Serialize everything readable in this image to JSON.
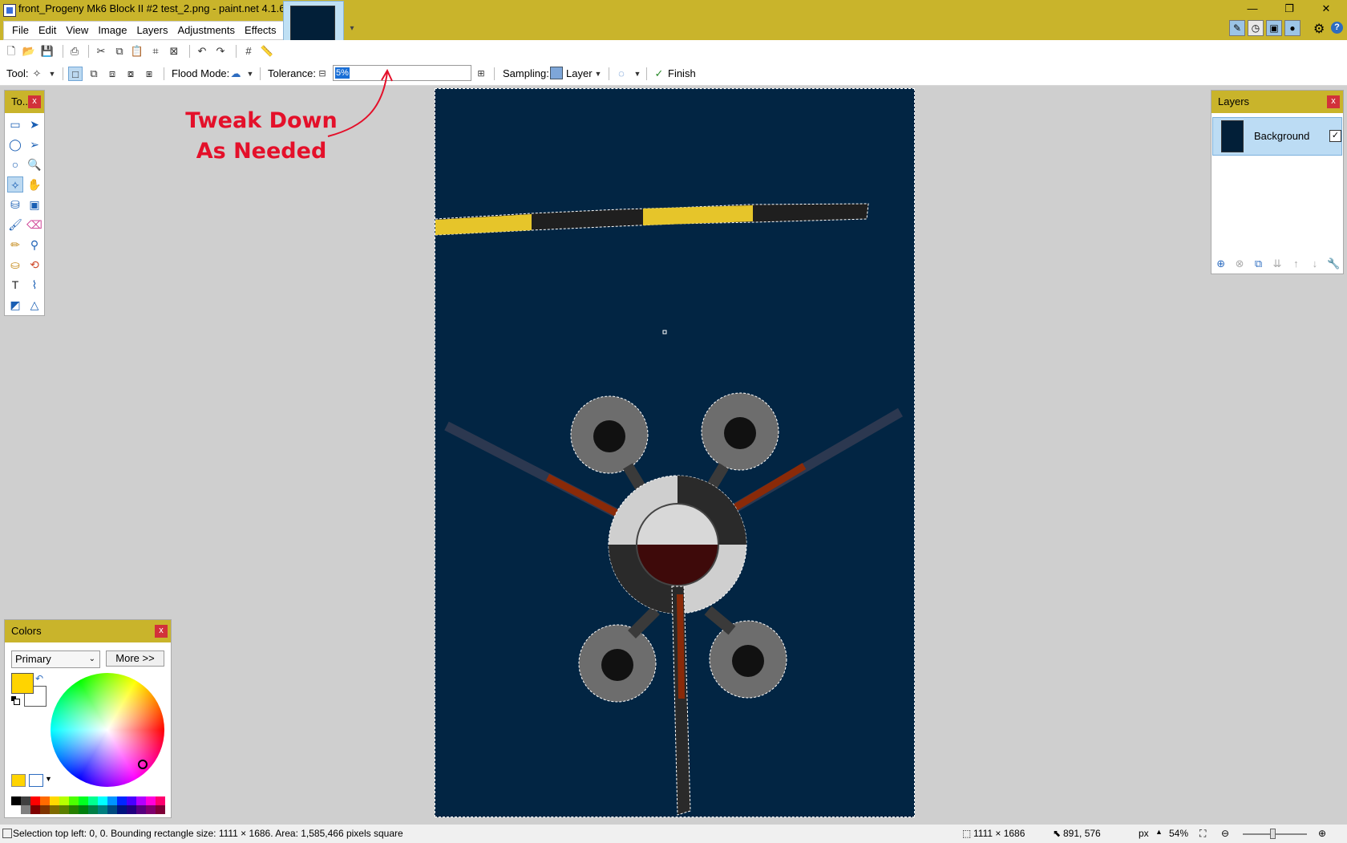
{
  "window": {
    "title": "front_Progeny Mk6 Block II #2 test_2.png - paint.net 4.1.6",
    "minimize": "—",
    "restore": "❐",
    "close": "✕"
  },
  "menu": [
    {
      "label": "File"
    },
    {
      "label": "Edit"
    },
    {
      "label": "View"
    },
    {
      "label": "Image"
    },
    {
      "label": "Layers"
    },
    {
      "label": "Adjustments"
    },
    {
      "label": "Effects"
    }
  ],
  "toolbar": {
    "tool_label": "Tool:",
    "flood_mode_label": "Flood Mode:",
    "tolerance_label": "Tolerance:",
    "tolerance_value": "5%",
    "tolerance_fraction": 0.05,
    "sampling_label": "Sampling:",
    "sampling_value": "Layer",
    "finish_label": "Finish"
  },
  "tools_panel": {
    "title": "To...",
    "close": "x"
  },
  "layers_panel": {
    "title": "Layers",
    "close": "x",
    "layers": [
      {
        "name": "Background",
        "visible": true
      }
    ]
  },
  "colors_panel": {
    "title": "Colors",
    "close": "x",
    "mode": "Primary",
    "more_button": "More >>",
    "primary_color": "#ffd400",
    "secondary_color": "#ffffff",
    "palette": [
      "#000000",
      "#404040",
      "#ff0000",
      "#ff6a00",
      "#ffd800",
      "#b6ff00",
      "#4cff00",
      "#00ff21",
      "#00ff90",
      "#00ffff",
      "#0094ff",
      "#0026ff",
      "#4800ff",
      "#b200ff",
      "#ff00dc",
      "#ff006e",
      "#ffffff",
      "#808080",
      "#7f0000",
      "#7f3300",
      "#7f6a00",
      "#5b7f00",
      "#267f00",
      "#007f0e",
      "#007f46",
      "#007f7f",
      "#004a7f",
      "#00137f",
      "#21007f",
      "#57007f",
      "#7f006e",
      "#7f0037"
    ]
  },
  "annotation": {
    "line1": "Tweak Down",
    "line2": "As Needed",
    "color": "#e4102a"
  },
  "status": {
    "selection_info": "Selection top left: 0, 0. Bounding rectangle size: 1111 × 1686. Area: 1,585,466 pixels square",
    "image_size": "1111 × 1686",
    "cursor_pos": "891, 576",
    "units": "px",
    "zoom": "54%"
  },
  "colors": {
    "titlebar": "#c9b42b",
    "canvas_bg": "#022543"
  }
}
